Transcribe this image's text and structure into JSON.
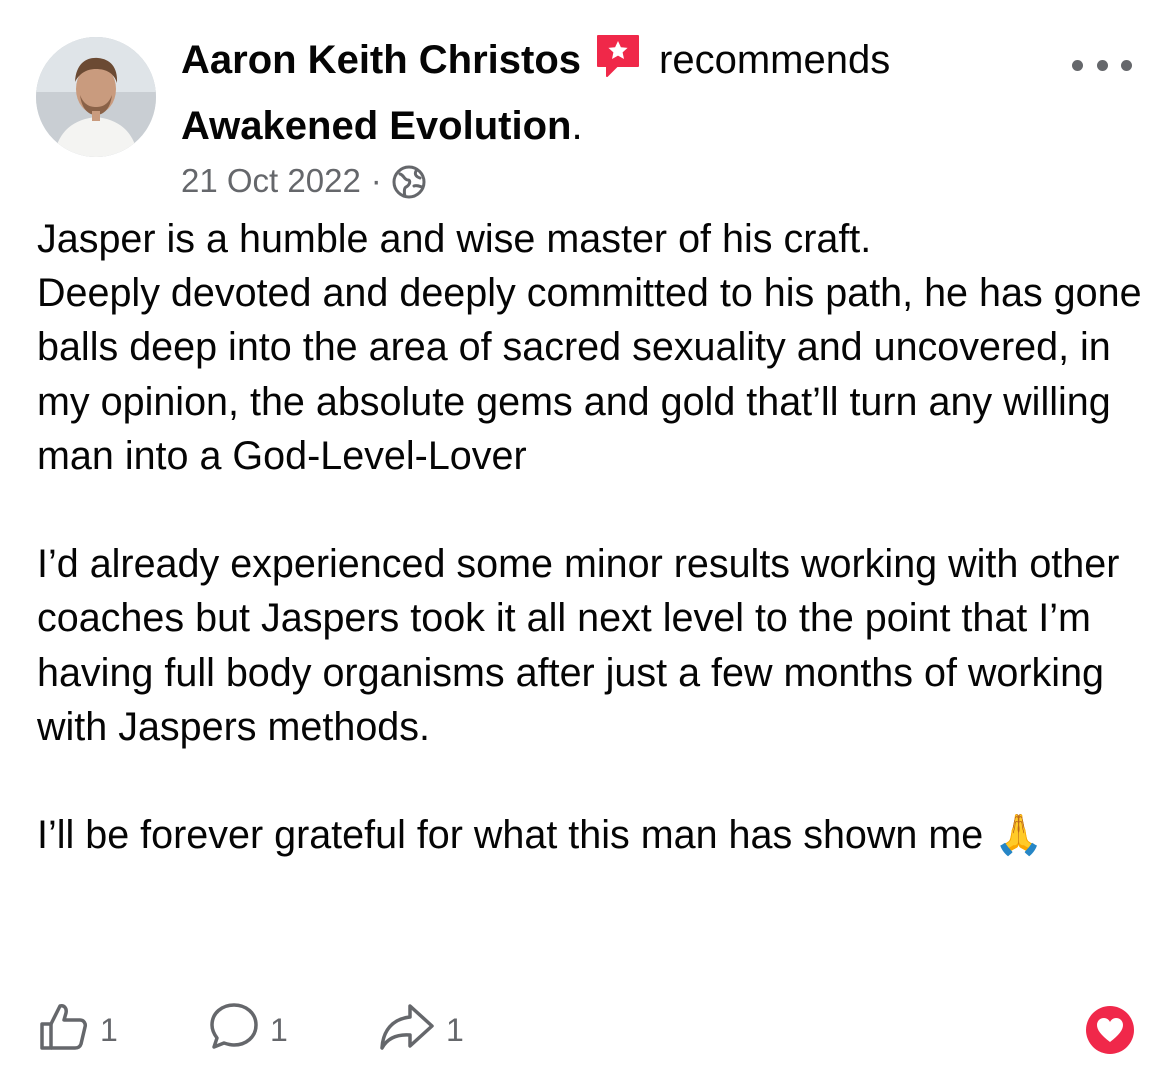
{
  "post": {
    "author": "Aaron Keith Christos",
    "action_text": "recommends",
    "page_name": "Awakened Evolution",
    "page_suffix": ".",
    "date": "21 Oct 2022",
    "separator": "·",
    "audience_icon": "globe-icon",
    "recommend_icon": "recommend-star-icon",
    "more_icon": "more-options-icon",
    "body": "Jasper is a humble and wise master of his craft.\nDeeply devoted and deeply committed to his path, he has gone balls deep into the area of sacred sexuality and uncovered, in my opinion, the absolute gems and gold that’ll turn any willing man into a God-Level-Lover\n\nI’d already experienced some minor results working with other coaches but Jaspers took it all next level to the point that I’m having full body organisms after just a few months of working with Jaspers methods.\n\nI’ll be forever grateful for what this man has shown me 🙏"
  },
  "footer": {
    "like_count": "1",
    "comment_count": "1",
    "share_count": "1",
    "like_icon": "thumbs-up-icon",
    "comment_icon": "comment-bubble-icon",
    "share_icon": "share-arrow-icon",
    "reaction_icon": "love-reaction-icon"
  },
  "colors": {
    "text": "#050505",
    "secondary": "#65676b",
    "recommend": "#f02849",
    "love": "#f0284a"
  }
}
